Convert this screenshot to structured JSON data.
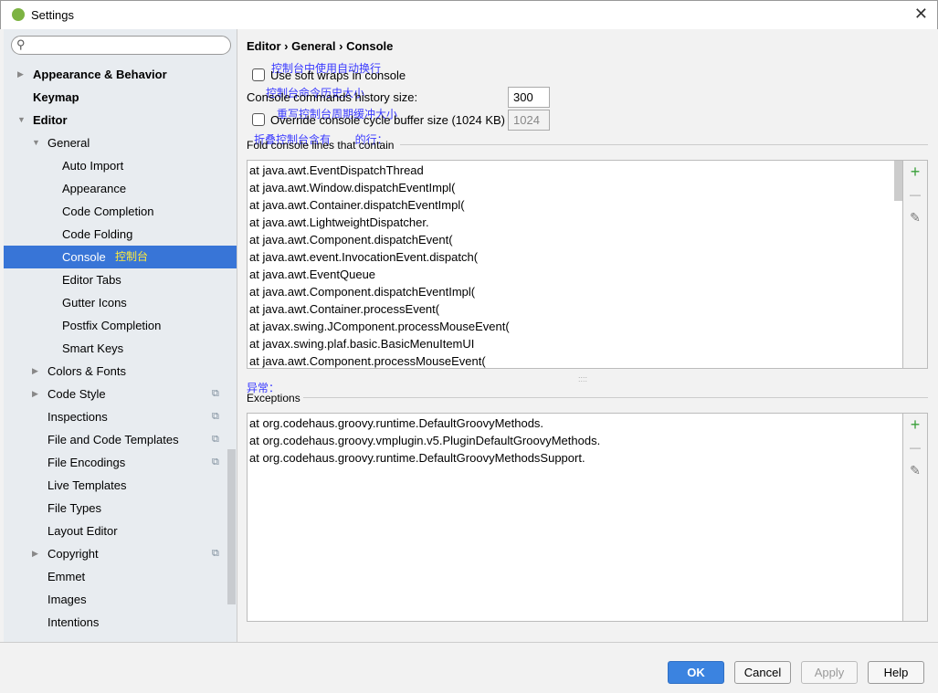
{
  "window": {
    "title": "Settings",
    "close": "✕"
  },
  "sidebar": {
    "search_placeholder": "",
    "items": [
      {
        "label": "Appearance & Behavior",
        "level": 0,
        "bold": true,
        "arrow": "▶"
      },
      {
        "label": "Keymap",
        "level": 0,
        "bold": true
      },
      {
        "label": "Editor",
        "level": 0,
        "bold": true,
        "arrow": "▼"
      },
      {
        "label": "General",
        "level": 1,
        "arrow": "▼"
      },
      {
        "label": "Auto Import",
        "level": 2
      },
      {
        "label": "Appearance",
        "level": 2
      },
      {
        "label": "Code Completion",
        "level": 2
      },
      {
        "label": "Code Folding",
        "level": 2
      },
      {
        "label": "Console",
        "level": 2,
        "selected": true,
        "annotation": "控制台"
      },
      {
        "label": "Editor Tabs",
        "level": 2
      },
      {
        "label": "Gutter Icons",
        "level": 2
      },
      {
        "label": "Postfix Completion",
        "level": 2
      },
      {
        "label": "Smart Keys",
        "level": 2
      },
      {
        "label": "Colors & Fonts",
        "level": 1,
        "arrow": "▶"
      },
      {
        "label": "Code Style",
        "level": 1,
        "arrow": "▶",
        "copy": true
      },
      {
        "label": "Inspections",
        "level": 1,
        "copy": true
      },
      {
        "label": "File and Code Templates",
        "level": 1,
        "copy": true
      },
      {
        "label": "File Encodings",
        "level": 1,
        "copy": true
      },
      {
        "label": "Live Templates",
        "level": 1
      },
      {
        "label": "File Types",
        "level": 1
      },
      {
        "label": "Layout Editor",
        "level": 1
      },
      {
        "label": "Copyright",
        "level": 1,
        "arrow": "▶",
        "copy": true
      },
      {
        "label": "Emmet",
        "level": 1
      },
      {
        "label": "Images",
        "level": 1
      },
      {
        "label": "Intentions",
        "level": 1
      }
    ]
  },
  "main": {
    "breadcrumb": "Editor › General › Console",
    "soft_wraps_label": "Use soft wraps in console",
    "soft_wraps_annotation": "控制台中使用自动换行",
    "history_label": "Console commands history size:",
    "history_annotation": "控制台命令历史大小",
    "history_value": "300",
    "override_label": "Override console cycle buffer size (1024 KB)",
    "override_annotation": "重写控制台周期缓冲大小",
    "override_value": "1024",
    "fold_label": "Fold console lines that contain",
    "fold_annotation": "折叠控制台含有        的行：",
    "fold_lines": [
      "at java.awt.EventDispatchThread",
      "at java.awt.Window.dispatchEventImpl(",
      "at java.awt.Container.dispatchEventImpl(",
      "at java.awt.LightweightDispatcher.",
      "at java.awt.Component.dispatchEvent(",
      "at java.awt.event.InvocationEvent.dispatch(",
      "at java.awt.EventQueue",
      "at java.awt.Component.dispatchEventImpl(",
      "at java.awt.Container.processEvent(",
      "at javax.swing.JComponent.processMouseEvent(",
      "at javax.swing.plaf.basic.BasicMenuItemUI",
      "at java.awt.Component.processMouseEvent("
    ],
    "exceptions_annotation": "异常：",
    "exceptions_label": "Exceptions",
    "exception_lines": [
      "at org.codehaus.groovy.runtime.DefaultGroovyMethods.",
      "at org.codehaus.groovy.vmplugin.v5.PluginDefaultGroovyMethods.",
      "at org.codehaus.groovy.runtime.DefaultGroovyMethodsSupport."
    ],
    "tools": {
      "add": "+",
      "remove": "—",
      "edit": "✎"
    }
  },
  "footer": {
    "ok": "OK",
    "cancel": "Cancel",
    "apply": "Apply",
    "help": "Help"
  }
}
